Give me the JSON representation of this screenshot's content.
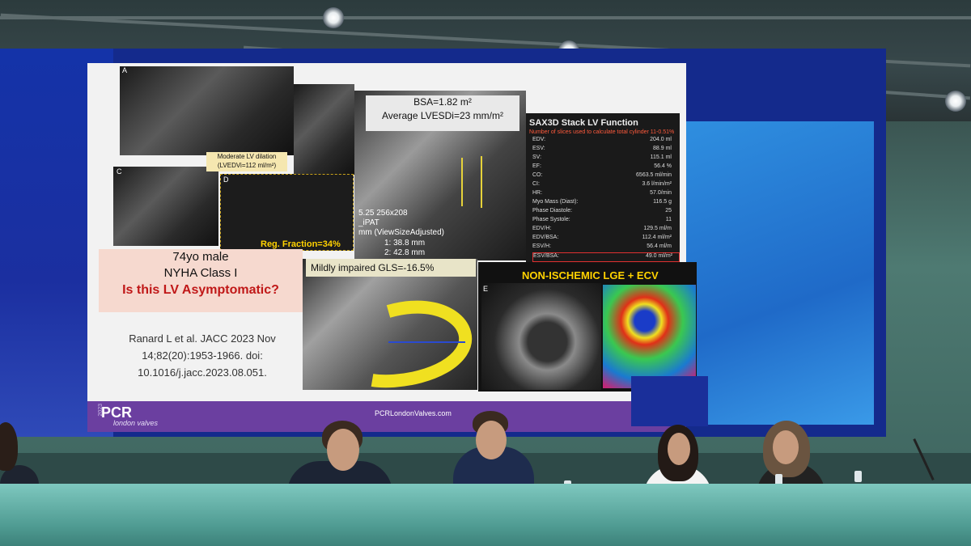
{
  "slide": {
    "bsa_line1": "BSA=1.82 m²",
    "bsa_line2": "Average LVESDi=23 mm/m²",
    "panel_letters": [
      "A",
      "C",
      "D",
      "E"
    ],
    "moderate_line1": "Moderate LV dilation",
    "moderate_line2": "(LVEDVi=112 ml/m²)",
    "reg_fraction": "Reg. Fraction=34%",
    "sax_title": "SAX3D Stack LV Function",
    "sax_subtitle": "Number of slices used to calculate total cylinder 11-0.51%",
    "sax_rows": [
      {
        "label": "EDV:",
        "value": "204.0 ml"
      },
      {
        "label": "ESV:",
        "value": "88.9 ml"
      },
      {
        "label": "SV:",
        "value": "115.1 ml"
      },
      {
        "label": "EF:",
        "value": "56.4 %"
      },
      {
        "label": "CO:",
        "value": "6563.5 ml/min"
      },
      {
        "label": "CI:",
        "value": "3.6 l/min/m²"
      },
      {
        "label": "HR:",
        "value": "57.0/min"
      },
      {
        "label": "Myo Mass (Diast):",
        "value": "116.5 g"
      },
      {
        "label": "Phase Diastole:",
        "value": "25"
      },
      {
        "label": "Phase Systole:",
        "value": "11"
      },
      {
        "label": "EDV/H:",
        "value": "129.5 ml/m"
      },
      {
        "label": "EDV/BSA:",
        "value": "112.4 ml/m²"
      },
      {
        "label": "ESV/H:",
        "value": "56.4 ml/m"
      },
      {
        "label": "ESV/BSA:",
        "value": "49.0 ml/m²"
      }
    ],
    "patient_line1": "74yo male",
    "patient_line2": "NYHA Class I",
    "patient_question": "Is this LV Asymptomatic?",
    "citation": "Ranard L et al. JACC 2023 Nov 14;82(20):1953-1966. doi: 10.1016/j.jacc.2023.08.051.",
    "gls_label": "Mildly impaired GLS=-16.5%",
    "lge_title": "NON-ISCHEMIC LGE + ECV",
    "measure_1": "1: 38.8 mm",
    "measure_2": "2: 42.8 mm",
    "mri_text1": "5.25 256x208",
    "mri_text2": "_iPAT",
    "mri_text3": "mm (ViewSizeAdjusted)"
  },
  "footer": {
    "logo": "PCR",
    "logo_sub": "london valves",
    "year": "2023",
    "url": "PCRLondonValves.com"
  },
  "colors": {
    "slide_purple": "#6b3fa0",
    "question_red": "#c01818",
    "highlight_yellow": "#ffd200"
  }
}
